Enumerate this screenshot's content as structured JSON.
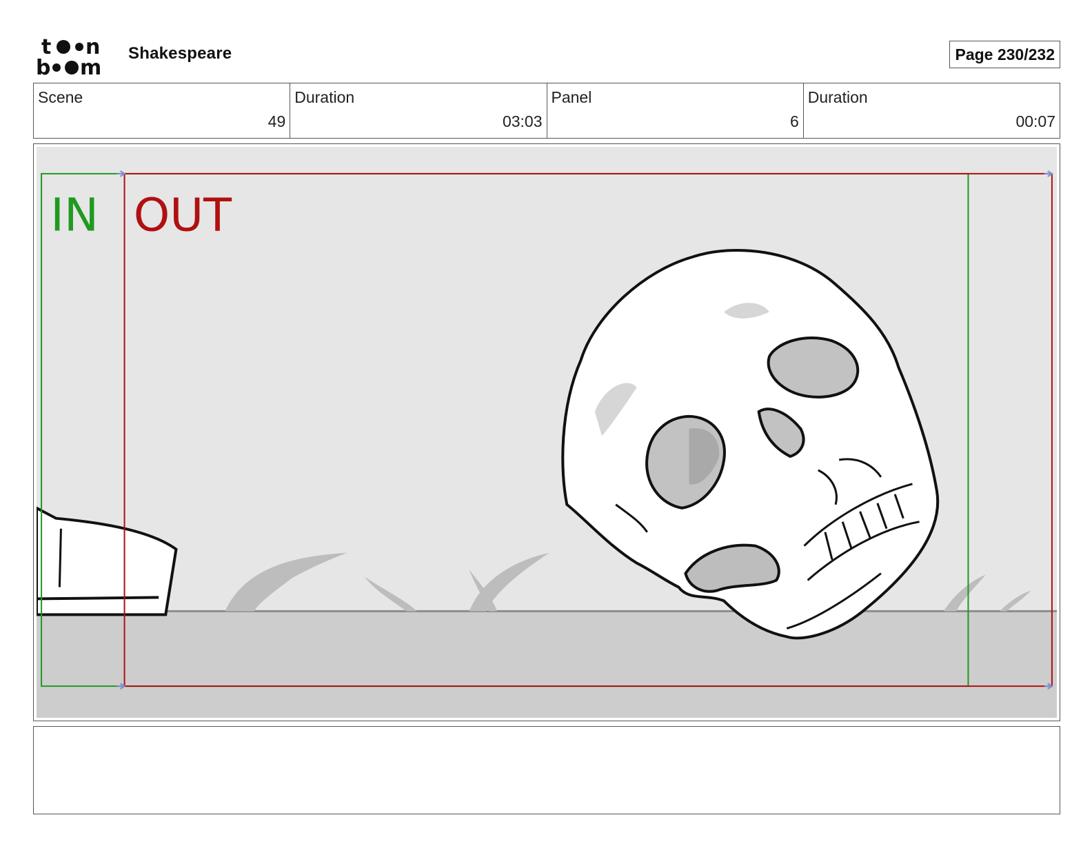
{
  "header": {
    "logo": {
      "line1": "toon",
      "line2": "boom",
      "icon": "toon-boom-logo"
    },
    "project_title": "Shakespeare",
    "page_label": "Page 230/232"
  },
  "info": {
    "scene_label": "Scene",
    "scene_value": "49",
    "scene_duration_label": "Duration",
    "scene_duration_value": "03:03",
    "panel_label": "Panel",
    "panel_value": "6",
    "panel_duration_label": "Duration",
    "panel_duration_value": "00:07"
  },
  "panel": {
    "in_label": "IN",
    "out_label": "OUT",
    "colors": {
      "in": "#1f9a1f",
      "out": "#b01010",
      "sky": "#e6e6e6",
      "ground": "#cccccc"
    }
  },
  "notes": {
    "text": ""
  }
}
